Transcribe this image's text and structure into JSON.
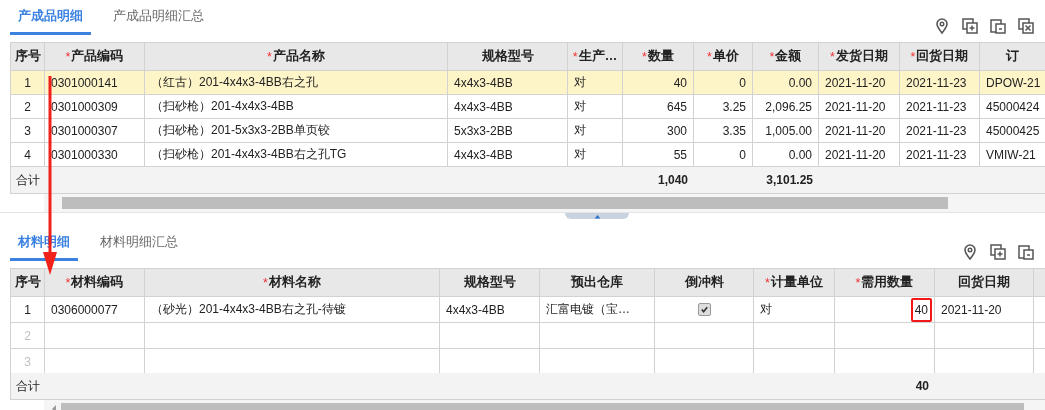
{
  "sections": [
    {
      "tabs": [
        {
          "label": "产成品明细",
          "selected": true
        },
        {
          "label": "产成品明细汇总",
          "selected": false
        }
      ],
      "table": {
        "columns": [
          {
            "label": "序号"
          },
          {
            "label": "产品编码",
            "mark": "*"
          },
          {
            "label": "产品名称",
            "mark": "*"
          },
          {
            "label": "规格型号"
          },
          {
            "label": "生产…",
            "mark": "*"
          },
          {
            "label": "数量",
            "mark": "*"
          },
          {
            "label": "单价",
            "mark": "*"
          },
          {
            "label": "金额",
            "mark": "*"
          },
          {
            "label": "发货日期",
            "mark": "*"
          },
          {
            "label": "回货日期",
            "mark": "*"
          },
          {
            "label": "订"
          }
        ],
        "rows": [
          {
            "selected": true,
            "empty": false,
            "cells": [
              "1",
              "0301000141",
              "（红古）201-4x4x3-4BB右之孔",
              "4x4x3-4BB",
              "对",
              "40",
              "0",
              "0.00",
              "2021-11-20",
              "2021-11-23",
              "DPOW-21"
            ]
          },
          {
            "selected": false,
            "empty": false,
            "cells": [
              "2",
              "0301000309",
              "（扫砂枪）201-4x4x3-4BB",
              "4x4x3-4BB",
              "对",
              "645",
              "3.25",
              "2,096.25",
              "2021-11-20",
              "2021-11-23",
              "45000424"
            ]
          },
          {
            "selected": false,
            "empty": false,
            "cells": [
              "3",
              "0301000307",
              "（扫砂枪）201-5x3x3-2BB单页铰",
              "5x3x3-2BB",
              "对",
              "300",
              "3.35",
              "1,005.00",
              "2021-11-20",
              "2021-11-23",
              "45000425"
            ]
          },
          {
            "selected": false,
            "empty": false,
            "cells": [
              "4",
              "0301000330",
              "（扫砂枪）201-4x4x3-4BB右之孔TG",
              "4x4x3-4BB",
              "对",
              "55",
              "0",
              "0.00",
              "2021-11-20",
              "2021-11-23",
              "VMIW-21"
            ]
          }
        ],
        "totals": {
          "label": "合计",
          "quantity": "1,040",
          "amount": "3,101.25"
        }
      }
    },
    {
      "tabs": [
        {
          "label": "材料明细",
          "selected": true
        },
        {
          "label": "材料明细汇总",
          "selected": false
        }
      ],
      "table": {
        "columns": [
          {
            "label": "序号"
          },
          {
            "label": "材料编码",
            "mark": "*"
          },
          {
            "label": "材料名称",
            "mark": "*"
          },
          {
            "label": "规格型号"
          },
          {
            "label": "预出仓库"
          },
          {
            "label": "倒冲料"
          },
          {
            "label": "计量单位",
            "mark": "*"
          },
          {
            "label": "需用数量",
            "mark": "*"
          },
          {
            "label": "回货日期"
          },
          {}
        ],
        "rows": [
          {
            "selected": false,
            "empty": false,
            "cells": [
              "1",
              "0306000077",
              "（砂光）201-4x4x3-4BB右之孔-待镀",
              "4x4x3-4BB",
              "汇富电镀（宝…",
              {
                "kind": "checkbox",
                "checked": true
              },
              "对",
              {
                "text": "40",
                "highlighted": true
              },
              "2021-11-20"
            ]
          },
          {
            "selected": false,
            "empty": true,
            "cells": [
              "2"
            ]
          },
          {
            "selected": false,
            "empty": true,
            "cells": [
              "3"
            ]
          }
        ],
        "totals": {
          "label": "合计",
          "required_quantity": "40"
        }
      }
    }
  ],
  "annotations": [
    {
      "kind": "arrow"
    }
  ]
}
